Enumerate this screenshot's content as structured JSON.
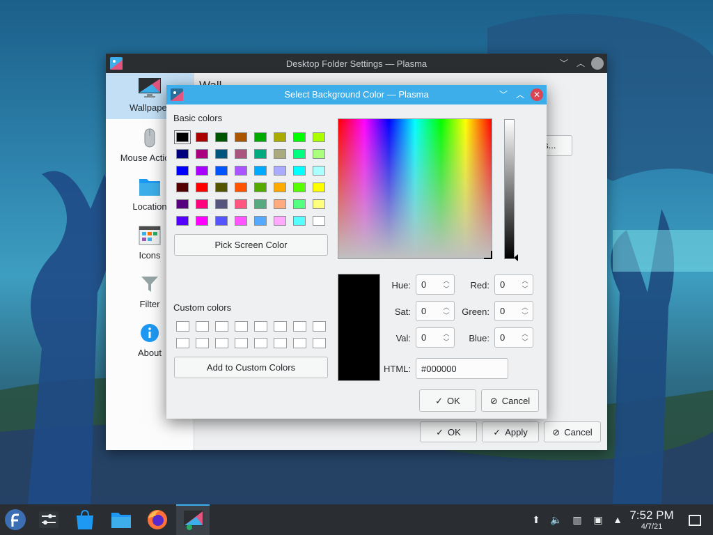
{
  "parent_window": {
    "title": "Desktop Folder Settings — Plasma",
    "sidebar": [
      {
        "label": "Wallpaper",
        "icon": "monitor-icon",
        "selected": true
      },
      {
        "label": "Mouse Actions",
        "icon": "mouse-icon"
      },
      {
        "label": "Location",
        "icon": "folder-icon"
      },
      {
        "label": "Icons",
        "icon": "icons-view-icon"
      },
      {
        "label": "Filter",
        "icon": "filter-icon"
      },
      {
        "label": "About",
        "icon": "info-icon"
      }
    ],
    "content_heading_peek": "Wall",
    "plugins_button": "ins...",
    "ok": "OK",
    "apply": "Apply",
    "cancel": "Cancel"
  },
  "dialog": {
    "title": "Select Background Color — Plasma",
    "basic_colors_label": "Basic colors",
    "basic_colors": [
      "#000000",
      "#aa0000",
      "#005500",
      "#aa5500",
      "#00aa00",
      "#aaaa00",
      "#00ff00",
      "#aaff00",
      "#00007f",
      "#aa007f",
      "#00557f",
      "#aa557f",
      "#00aa7f",
      "#aaaa7f",
      "#00ff7f",
      "#aaff7f",
      "#0000ff",
      "#aa00ff",
      "#0055ff",
      "#aa55ff",
      "#00aaff",
      "#aaaaff",
      "#00ffff",
      "#aaffff",
      "#550000",
      "#ff0000",
      "#555500",
      "#ff5500",
      "#55aa00",
      "#ffaa00",
      "#55ff00",
      "#ffff00",
      "#55007f",
      "#ff007f",
      "#55557f",
      "#ff557f",
      "#55aa7f",
      "#ffaa7f",
      "#55ff7f",
      "#ffff7f",
      "#5500ff",
      "#ff00ff",
      "#5555ff",
      "#ff55ff",
      "#55aaff",
      "#ffaaff",
      "#55ffff",
      "#ffffff"
    ],
    "pick_screen_color": "Pick Screen Color",
    "custom_colors_label": "Custom colors",
    "add_to_custom": "Add to Custom Colors",
    "fields": {
      "hue_label": "Hue:",
      "hue": "0",
      "sat_label": "Sat:",
      "sat": "0",
      "val_label": "Val:",
      "val": "0",
      "red_label": "Red:",
      "red": "0",
      "green_label": "Green:",
      "green": "0",
      "blue_label": "Blue:",
      "blue": "0",
      "html_label": "HTML:",
      "html": "#000000"
    },
    "current_color": "#000000",
    "ok": "OK",
    "cancel": "Cancel"
  },
  "taskbar": {
    "time": "7:52 PM",
    "date": "4/7/21"
  }
}
